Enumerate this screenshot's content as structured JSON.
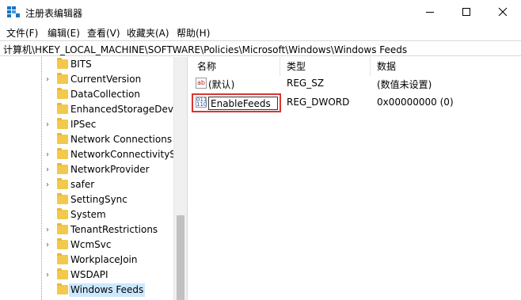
{
  "window": {
    "title": "注册表编辑器",
    "icon": "registry-editor-icon"
  },
  "menu": {
    "items": [
      {
        "label": "文件(F)"
      },
      {
        "label": "编辑(E)"
      },
      {
        "label": "查看(V)"
      },
      {
        "label": "收藏夹(A)"
      },
      {
        "label": "帮助(H)"
      }
    ]
  },
  "address": {
    "path": "计算机\\HKEY_LOCAL_MACHINE\\SOFTWARE\\Policies\\Microsoft\\Windows\\Windows Feeds"
  },
  "tree": {
    "items": [
      {
        "label": "BITS",
        "expandable": false
      },
      {
        "label": "CurrentVersion",
        "expandable": true
      },
      {
        "label": "DataCollection",
        "expandable": false
      },
      {
        "label": "EnhancedStorageDevice",
        "expandable": false
      },
      {
        "label": "IPSec",
        "expandable": true
      },
      {
        "label": "Network Connections",
        "expandable": false
      },
      {
        "label": "NetworkConnectivitySta",
        "expandable": true
      },
      {
        "label": "NetworkProvider",
        "expandable": true
      },
      {
        "label": "safer",
        "expandable": true
      },
      {
        "label": "SettingSync",
        "expandable": false
      },
      {
        "label": "System",
        "expandable": false
      },
      {
        "label": "TenantRestrictions",
        "expandable": true
      },
      {
        "label": "WcmSvc",
        "expandable": true
      },
      {
        "label": "WorkplaceJoin",
        "expandable": false
      },
      {
        "label": "WSDAPI",
        "expandable": true
      },
      {
        "label": "Windows Feeds",
        "expandable": false,
        "selected": true
      }
    ]
  },
  "list": {
    "columns": {
      "name": "名称",
      "type": "类型",
      "data": "数据"
    },
    "rows": [
      {
        "icon": "string-value-icon",
        "name": "(默认)",
        "type": "REG_SZ",
        "data": "(数值未设置)"
      },
      {
        "icon": "dword-value-icon",
        "name": "EnableFeeds",
        "type": "REG_DWORD",
        "data": "0x00000000 (0)",
        "editing": true
      }
    ]
  },
  "colors": {
    "highlight": "#d93434",
    "selection": "#cce8ff",
    "folder": "#f2c94c"
  }
}
